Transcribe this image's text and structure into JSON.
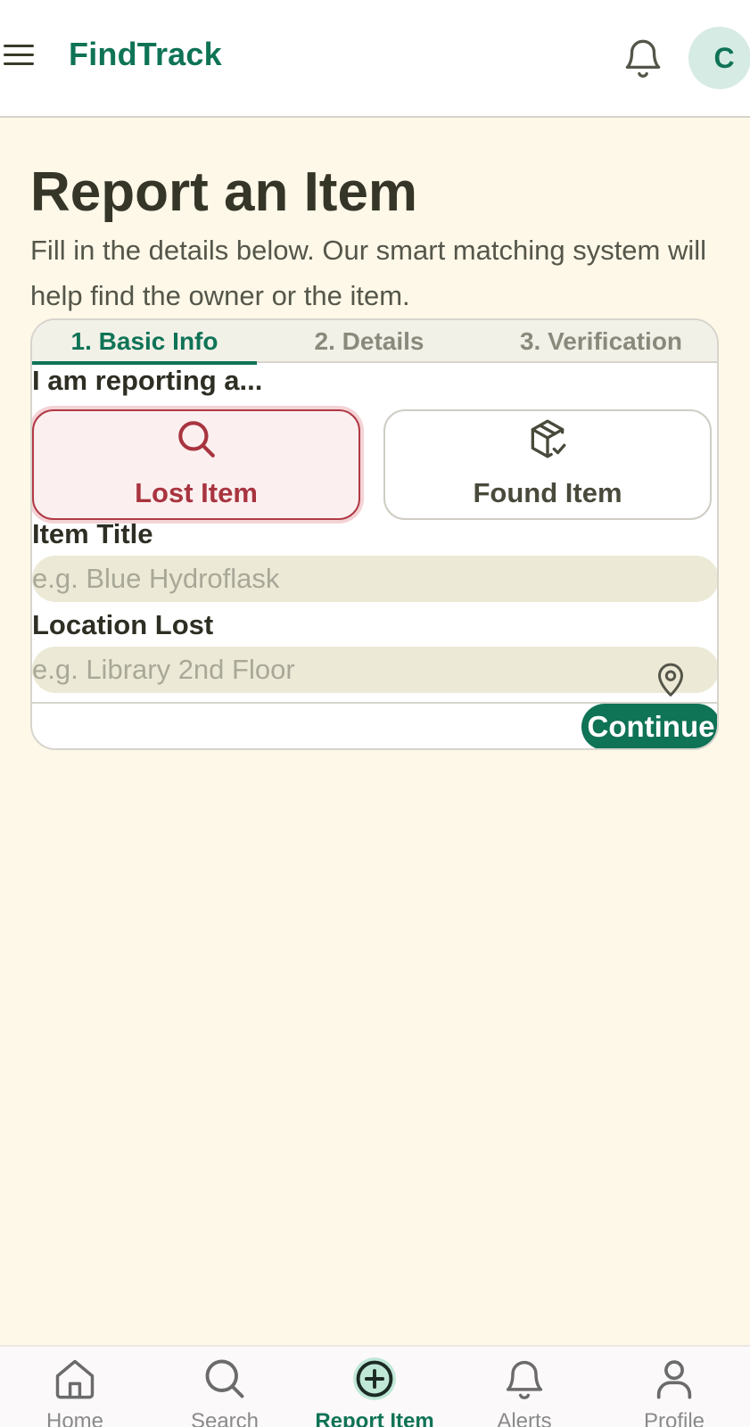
{
  "header": {
    "app_title": "FindTrack",
    "avatar_initial": "C"
  },
  "page": {
    "title": "Report an Item",
    "subtitle": "Fill in the details below. Our smart matching system will help find the owner or the item."
  },
  "steps": [
    {
      "label": "1. Basic Info",
      "active": true
    },
    {
      "label": "2. Details",
      "active": false
    },
    {
      "label": "3. Verification",
      "active": false
    }
  ],
  "form": {
    "report_type_label": "I am reporting a...",
    "options": [
      {
        "label": "Lost Item",
        "icon": "search-icon",
        "selected": true
      },
      {
        "label": "Found Item",
        "icon": "package-check-icon",
        "selected": false
      }
    ],
    "item_title_label": "Item Title",
    "item_title_placeholder": "e.g. Blue Hydroflask",
    "item_title_value": "",
    "location_label": "Location Lost",
    "location_placeholder": "e.g. Library 2nd Floor",
    "location_value": "",
    "continue_label": "Continue"
  },
  "bottom_nav": [
    {
      "label": "Home",
      "icon": "home-icon",
      "active": false
    },
    {
      "label": "Search",
      "icon": "search-icon",
      "active": false
    },
    {
      "label": "Report Item",
      "icon": "plus-circle-icon",
      "active": true
    },
    {
      "label": "Alerts",
      "icon": "bell-icon",
      "active": false
    },
    {
      "label": "Profile",
      "icon": "user-icon",
      "active": false
    }
  ],
  "colors": {
    "brand": "#0f7356",
    "background": "#fdf8e8",
    "lost_accent": "#a8343f",
    "input_bg": "#ecead6"
  }
}
